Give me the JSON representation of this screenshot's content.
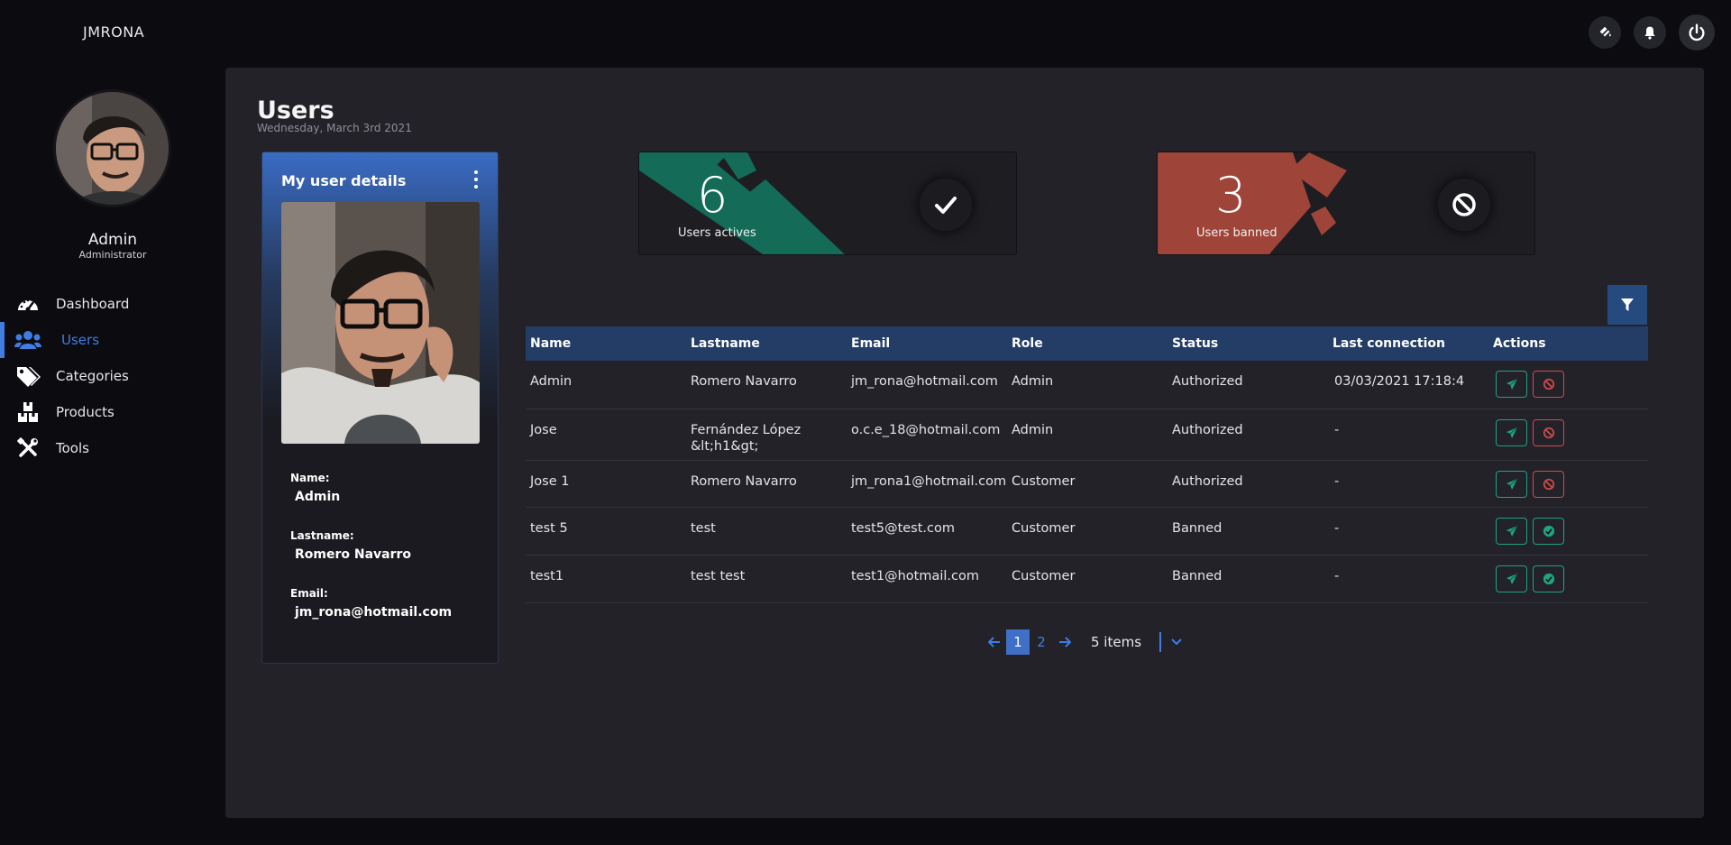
{
  "app": {
    "brand": "JMRONA"
  },
  "topbar": {
    "icons": [
      "paint-bucket-icon",
      "bell-icon",
      "power-icon"
    ]
  },
  "profile": {
    "name": "Admin",
    "role": "Administrator"
  },
  "sidebar": {
    "items": [
      {
        "label": "Dashboard",
        "icon": "speedometer-icon",
        "active": false
      },
      {
        "label": "Users",
        "icon": "users-icon",
        "active": true
      },
      {
        "label": "Categories",
        "icon": "tags-icon",
        "active": false
      },
      {
        "label": "Products",
        "icon": "boxes-icon",
        "active": false
      },
      {
        "label": "Tools",
        "icon": "tools-icon",
        "active": false
      }
    ]
  },
  "page": {
    "title": "Users",
    "date": "Wednesday, March 3rd 2021"
  },
  "user_card": {
    "title": "My user details",
    "name_label": "Name:",
    "name_value": "Admin",
    "lastname_label": "Lastname:",
    "lastname_value": "Romero Navarro",
    "email_label": "Email:",
    "email_value": "jm_rona@hotmail.com"
  },
  "stats": {
    "active": {
      "count": "6",
      "label": "Users actives",
      "color": "#136b58"
    },
    "banned": {
      "count": "3",
      "label": "Users banned",
      "color": "#9e4438"
    }
  },
  "table": {
    "headers": [
      "Name",
      "Lastname",
      "Email",
      "Role",
      "Status",
      "Last connection",
      "Actions"
    ],
    "rows": [
      {
        "name": "Admin",
        "lastname": "Romero Navarro",
        "email": "jm_rona@hotmail.com",
        "role": "Admin",
        "status": "Authorized",
        "last": "03/03/2021 17:18:4",
        "second_action": "ban"
      },
      {
        "name": "Jose",
        "lastname": "Fernández López &lt;h1&gt;",
        "email": "o.c.e_18@hotmail.com",
        "role": "Admin",
        "status": "Authorized",
        "last": "-",
        "second_action": "ban"
      },
      {
        "name": "Jose 1",
        "lastname": "Romero Navarro",
        "email": "jm_rona1@hotmail.com",
        "role": "Customer",
        "status": "Authorized",
        "last": "-",
        "second_action": "ban"
      },
      {
        "name": "test 5",
        "lastname": "test",
        "email": "test5@test.com",
        "role": "Customer",
        "status": "Banned",
        "last": "-",
        "second_action": "authorize"
      },
      {
        "name": "test1",
        "lastname": "test test",
        "email": "test1@hotmail.com",
        "role": "Customer",
        "status": "Banned",
        "last": "-",
        "second_action": "authorize"
      }
    ]
  },
  "pagination": {
    "pages": [
      "1",
      "2"
    ],
    "current": "1",
    "items": "5 items"
  },
  "colors": {
    "accent": "#3f7ee0",
    "teal": "#1fa383",
    "red": "#cf4b4b",
    "header": "#233d67"
  }
}
